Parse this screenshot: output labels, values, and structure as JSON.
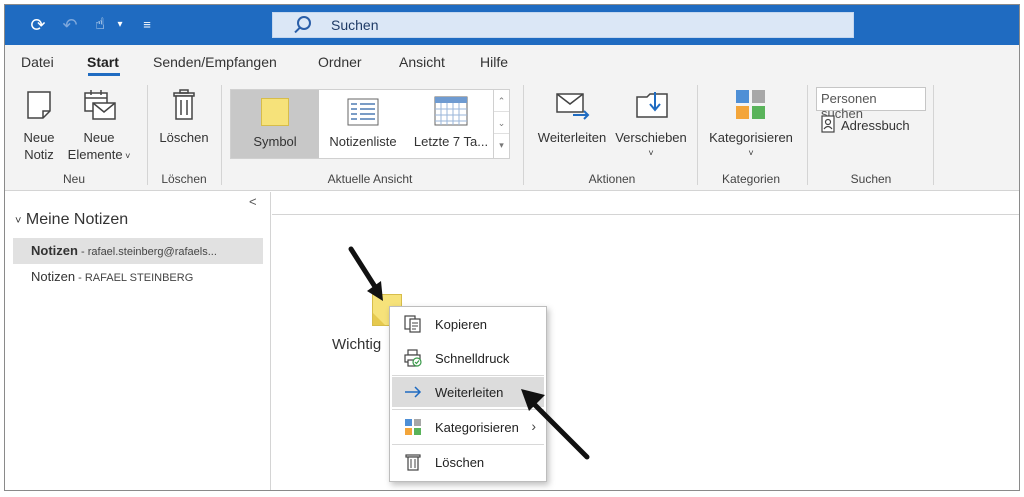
{
  "titlebar": {
    "search_placeholder": "Suchen",
    "icons": [
      "sync-icon",
      "undo-icon",
      "touch-mode-icon",
      "dropdown-icon",
      "customize-icon"
    ]
  },
  "tabs": [
    "Datei",
    "Start",
    "Senden/Empfangen",
    "Ordner",
    "Ansicht",
    "Hilfe"
  ],
  "active_tab": "Start",
  "ribbon": {
    "neu": {
      "new_note_l1": "Neue",
      "new_note_l2": "Notiz",
      "new_items_l1": "Neue",
      "new_items_l2": "Elemente",
      "group": "Neu"
    },
    "loeschen": {
      "delete": "Löschen",
      "group": "Löschen"
    },
    "ansicht": {
      "items": [
        "Symbol",
        "Notizenliste",
        "Letzte 7 Ta..."
      ],
      "group": "Aktuelle Ansicht"
    },
    "aktionen": {
      "forward": "Weiterleiten",
      "move": "Verschieben",
      "group": "Aktionen"
    },
    "kategorien": {
      "categorize": "Kategorisieren",
      "group": "Kategorien"
    },
    "suchen": {
      "people_search": "Personen suchen",
      "address_book": "Adressbuch",
      "group": "Suchen"
    }
  },
  "leftpane": {
    "collapse": "<",
    "header": "Meine Notizen",
    "folders": [
      {
        "name": "Notizen",
        "account": " - rafael.steinberg@rafaels...",
        "selected": true
      },
      {
        "name": "Notizen",
        "account": " - RAFAEL STEINBERG",
        "selected": false
      }
    ]
  },
  "content": {
    "note_label": "Wichtig"
  },
  "context_menu": {
    "items": [
      {
        "label": "Kopieren",
        "icon": "copy-icon"
      },
      {
        "label": "Schnelldruck",
        "icon": "quick-print-icon"
      },
      {
        "label": "Weiterleiten",
        "icon": "forward-arrow-icon",
        "highlighted": true
      },
      {
        "label": "Kategorisieren",
        "icon": "categorize-icon",
        "submenu": true
      },
      {
        "label": "Löschen",
        "icon": "trash-icon"
      }
    ]
  },
  "colors": {
    "titlebar": "#1f6bc1",
    "ribbon_bg": "#f3f3f3",
    "note_yellow": "#f6e27a",
    "highlight": "#dcdcdc"
  }
}
